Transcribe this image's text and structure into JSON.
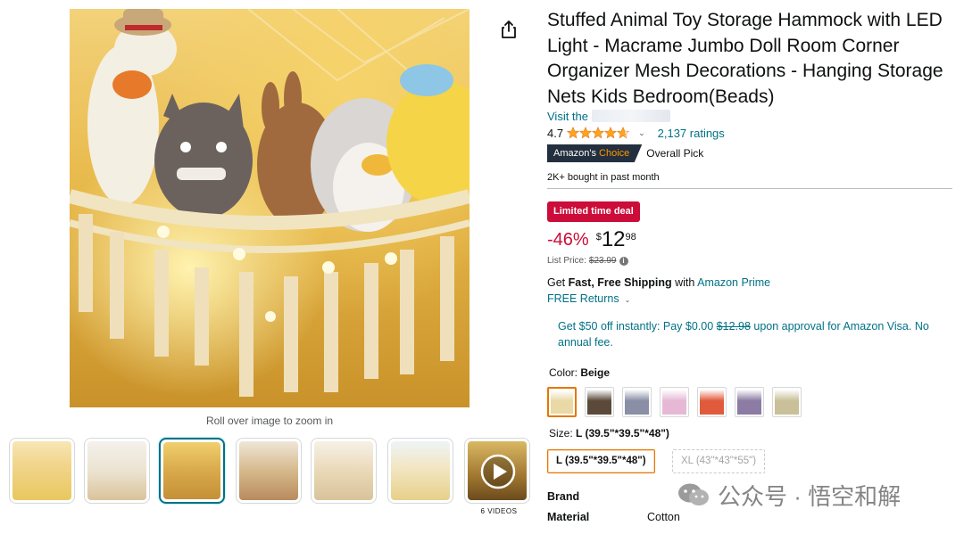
{
  "product": {
    "title": "Stuffed Animal Toy Storage Hammock with LED Light - Macrame Jumbo Doll Room Corner Organizer Mesh Decorations - Hanging Storage Nets Kids Bedroom(Beads)",
    "visit_prefix": "Visit the",
    "rating_value": "4.7",
    "rating_stars": 4.7,
    "ratings_count": "2,137 ratings",
    "choice_prefix": "Amazon's",
    "choice_suffix": "Choice",
    "choice_label": "Overall Pick",
    "bought": "2K+ bought in past month"
  },
  "media": {
    "zoom_hint": "Roll over image to zoom in",
    "videos_label": "6 VIDEOS",
    "thumb_count": 7,
    "selected_thumb": 3
  },
  "price": {
    "deal_badge": "Limited time deal",
    "discount": "-46%",
    "currency": "$",
    "whole": "12",
    "fraction": "98",
    "list_label": "List Price:",
    "list_price": "$23.99",
    "info_icon": "i"
  },
  "shipping": {
    "prefix": "Get ",
    "bold": "Fast, Free Shipping",
    "mid": " with ",
    "link": "Amazon Prime",
    "returns": "FREE Returns"
  },
  "visa": {
    "part1": "Get $50 off instantly: Pay $0.00 ",
    "strike": "$12.98",
    "part2": " upon approval for Amazon Visa. No annual fee."
  },
  "color": {
    "label": "Color: ",
    "value": "Beige",
    "selected_index": 0,
    "swatch_colors": [
      "#e9d9a6",
      "#5b4a3a",
      "#8a8fa6",
      "#e6b8d6",
      "#e05b3c",
      "#8c7ba3",
      "#c9c099"
    ]
  },
  "size": {
    "label": "Size: ",
    "value": "L (39.5\"*39.5\"*48\")",
    "options": [
      "L (39.5\"*39.5\"*48\")",
      "XL (43\"*43\"*55\")"
    ]
  },
  "specs": {
    "brand_label": "Brand",
    "material_label": "Material",
    "material_value": "Cotton"
  },
  "watermark": {
    "text": "公众号 · 悟空和解"
  },
  "colors": {
    "link": "#007185",
    "deal_red": "#cc0c39",
    "star": "#ffa41c",
    "choice_bg": "#232f3e",
    "selected_orange": "#e77600"
  }
}
